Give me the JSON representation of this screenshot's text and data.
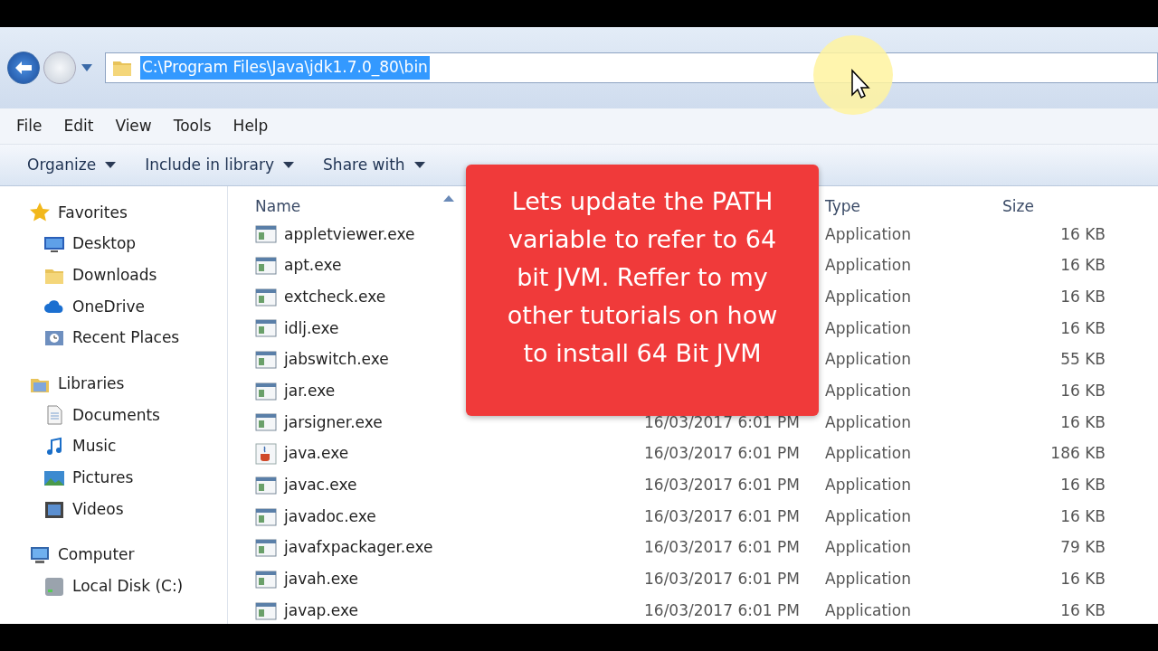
{
  "address_bar": {
    "path": "C:\\Program Files\\Java\\jdk1.7.0_80\\bin",
    "selected": true
  },
  "menu": [
    "File",
    "Edit",
    "View",
    "Tools",
    "Help"
  ],
  "toolbar": [
    {
      "label": "Organize",
      "dropdown": true
    },
    {
      "label": "Include in library",
      "dropdown": true
    },
    {
      "label": "Share with",
      "dropdown": true
    }
  ],
  "sidebar": [
    {
      "label": "Favorites",
      "kind": "star",
      "children": [
        {
          "label": "Desktop",
          "kind": "desktop"
        },
        {
          "label": "Downloads",
          "kind": "folder"
        },
        {
          "label": "OneDrive",
          "kind": "cloud"
        },
        {
          "label": "Recent Places",
          "kind": "recent"
        }
      ]
    },
    {
      "label": "Libraries",
      "kind": "library",
      "children": [
        {
          "label": "Documents",
          "kind": "document"
        },
        {
          "label": "Music",
          "kind": "music"
        },
        {
          "label": "Pictures",
          "kind": "picture"
        },
        {
          "label": "Videos",
          "kind": "video"
        }
      ]
    },
    {
      "label": "Computer",
      "kind": "computer",
      "children": [
        {
          "label": "Local Disk (C:)",
          "kind": "disk"
        }
      ]
    }
  ],
  "table": {
    "columns": [
      "Name",
      "Type",
      "Size"
    ],
    "rows": [
      {
        "name": "appletviewer.exe",
        "type": "Application",
        "size": "16 KB",
        "kind": "exe"
      },
      {
        "name": "apt.exe",
        "type": "Application",
        "size": "16 KB",
        "kind": "exe"
      },
      {
        "name": "extcheck.exe",
        "type": "Application",
        "size": "16 KB",
        "kind": "exe"
      },
      {
        "name": "idlj.exe",
        "type": "Application",
        "size": "16 KB",
        "kind": "exe"
      },
      {
        "name": "jabswitch.exe",
        "type": "Application",
        "size": "55 KB",
        "kind": "exe"
      },
      {
        "name": "jar.exe",
        "type": "Application",
        "size": "16 KB",
        "kind": "exe"
      },
      {
        "name": "jarsigner.exe",
        "date": "16/03/2017 6:01 PM",
        "type": "Application",
        "size": "16 KB",
        "kind": "exe"
      },
      {
        "name": "java.exe",
        "date": "16/03/2017 6:01 PM",
        "type": "Application",
        "size": "186 KB",
        "kind": "java"
      },
      {
        "name": "javac.exe",
        "date": "16/03/2017 6:01 PM",
        "type": "Application",
        "size": "16 KB",
        "kind": "exe"
      },
      {
        "name": "javadoc.exe",
        "date": "16/03/2017 6:01 PM",
        "type": "Application",
        "size": "16 KB",
        "kind": "exe"
      },
      {
        "name": "javafxpackager.exe",
        "date": "16/03/2017 6:01 PM",
        "type": "Application",
        "size": "79 KB",
        "kind": "exe"
      },
      {
        "name": "javah.exe",
        "date": "16/03/2017 6:01 PM",
        "type": "Application",
        "size": "16 KB",
        "kind": "exe"
      },
      {
        "name": "javap.exe",
        "date": "16/03/2017 6:01 PM",
        "type": "Application",
        "size": "16 KB",
        "kind": "exe"
      }
    ]
  },
  "callout": "Lets update the PATH variable to refer to 64 bit JVM. Reffer to my other tutorials on how to install 64 Bit JVM"
}
